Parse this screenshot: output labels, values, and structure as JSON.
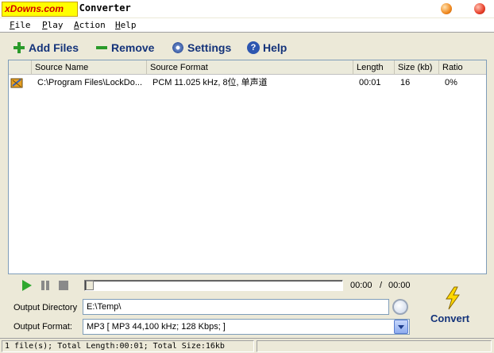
{
  "window": {
    "title": "io Converter",
    "watermark": "xDowns.com"
  },
  "menu": [
    {
      "key": "F",
      "rest": "ile"
    },
    {
      "key": "P",
      "rest": "lay"
    },
    {
      "key": "A",
      "rest": "ction"
    },
    {
      "key": "H",
      "rest": "elp"
    }
  ],
  "toolbar": {
    "add_files": "Add Files",
    "remove": "Remove",
    "settings": "Settings",
    "help": "Help"
  },
  "list": {
    "columns": [
      "",
      "Source Name",
      "Source Format",
      "Length",
      "Size (kb)",
      "Ratio"
    ],
    "rows": [
      {
        "source_name": "C:\\Program Files\\LockDo...",
        "source_format": "PCM 11.025 kHz, 8位, 单声道",
        "length": "00:01",
        "size": "16",
        "ratio": "0%"
      }
    ]
  },
  "player": {
    "current_time": "00:00",
    "separator": "/",
    "total_time": "00:00",
    "position_fraction": 0.0
  },
  "output": {
    "directory_label": "Output Directory",
    "directory_value": "E:\\Temp\\",
    "format_label": "Output Format:",
    "format_value": "MP3  [ MP3 44,100 kHz;  128 Kbps;  ]"
  },
  "convert_label": "Convert",
  "status": {
    "text": "1 file(s); Total Length:00:01; Total Size:16kb",
    "second_panel": ""
  },
  "colors": {
    "accent_text": "#14337a",
    "play_green": "#2fa82f",
    "bolt_yellow": "#ffd800",
    "watermark_bg": "#ffff00"
  }
}
